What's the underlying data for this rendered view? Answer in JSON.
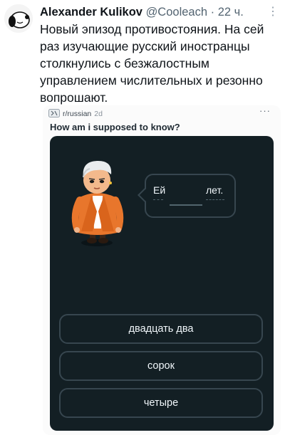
{
  "tweet": {
    "author_name": "Alexander Kulikov",
    "handle": "@Cooleach",
    "separator": "·",
    "time": "22 ч.",
    "more": "⋮",
    "text": "Новый эпизод противостояния. На сей раз изучающие русский иностранцы столкнулись с безжалостным управлением числительных и резонно вопрошают."
  },
  "reddit": {
    "subreddit": "r/russian",
    "age": "2d",
    "more": "···",
    "title": "How am i supposed to know?"
  },
  "exercise": {
    "word_before": "Ей",
    "word_after": "лет.",
    "options": [
      "двадцать два",
      "сорок",
      "четыре"
    ]
  }
}
